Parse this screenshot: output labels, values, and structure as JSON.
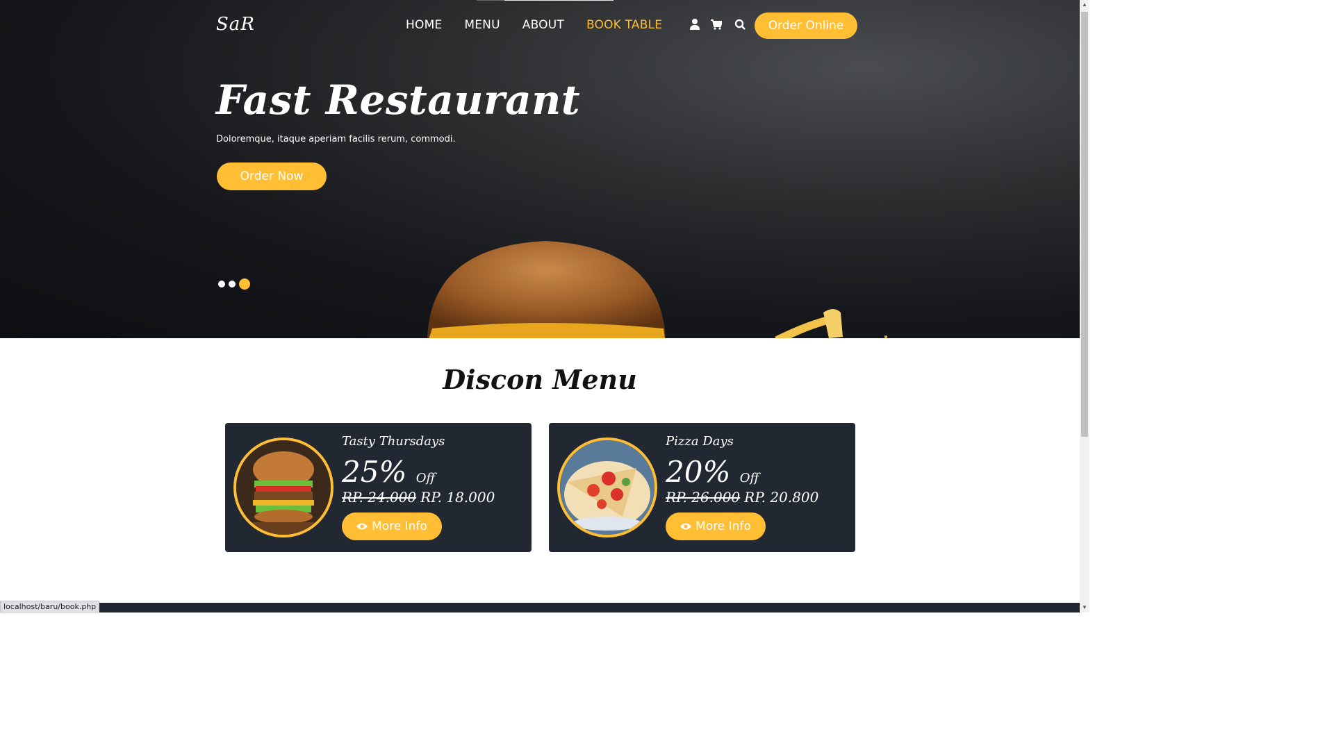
{
  "logo": "SaR",
  "nav": [
    {
      "label": "HOME",
      "active": false
    },
    {
      "label": "MENU",
      "active": false
    },
    {
      "label": "ABOUT",
      "active": false
    },
    {
      "label": "BOOK TABLE",
      "active": true
    }
  ],
  "icons": [
    "user-icon",
    "cart-icon",
    "search-icon"
  ],
  "order_online": "Order Online",
  "hero": {
    "title": "Fast Restaurant",
    "subtitle": "Doloremque, itaque aperiam facilis rerum, commodi.",
    "button": "Order Now",
    "carousel_active_index": 2,
    "carousel_count": 3
  },
  "section_title": "Discon Menu",
  "offers": [
    {
      "name": "Tasty Thursdays",
      "percent": "25%",
      "off": "Off",
      "old_price": "RP. 24.000",
      "new_price": "RP. 18.000",
      "button": "More Info"
    },
    {
      "name": "Pizza Days",
      "percent": "20%",
      "off": "Off",
      "old_price": "RP. 26.000",
      "new_price": "RP. 20.800",
      "button": "More Info"
    }
  ],
  "status_url": "localhost/baru/book.php",
  "colors": {
    "accent": "#ffbe33",
    "card_bg": "#222831"
  }
}
